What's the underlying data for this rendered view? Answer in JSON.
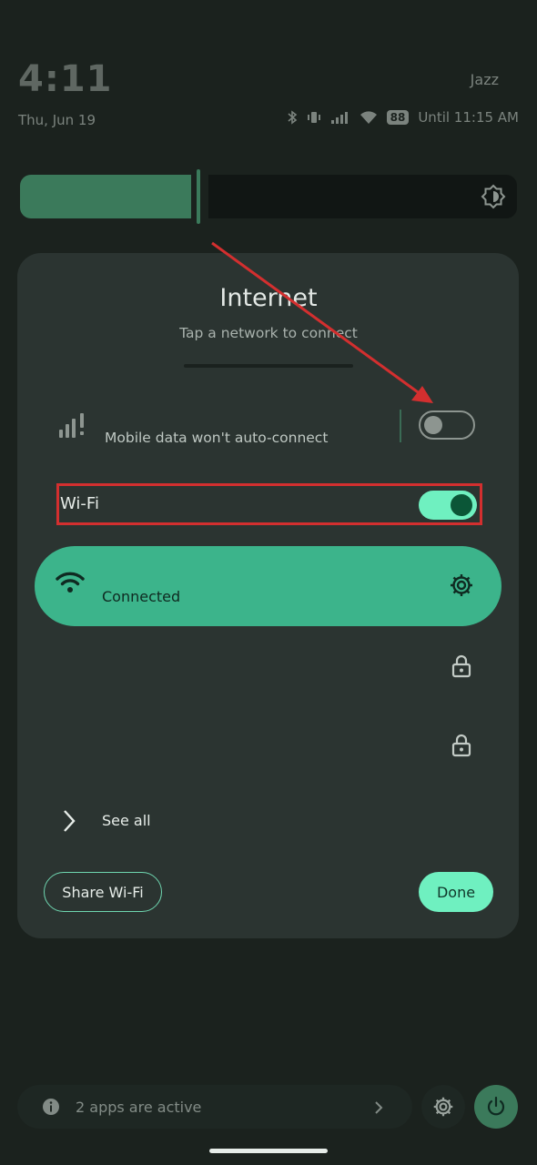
{
  "status_bar": {
    "time": "4:11",
    "date": "Thu, Jun 19",
    "carrier": "Jazz",
    "battery": "88",
    "alarm": "Until 11:15 AM"
  },
  "dialog": {
    "title": "Internet",
    "subtitle": "Tap a network to connect",
    "mobile_data_status": "Mobile data won't auto-connect",
    "mobile_data_enabled": false,
    "wifi_label": "Wi-Fi",
    "wifi_enabled": true,
    "connected_network_status": "Connected",
    "see_all_label": "See all",
    "share_button": "Share Wi-Fi",
    "done_button": "Done"
  },
  "bottom_bar": {
    "active_apps": "2 apps are active"
  },
  "annotations": {
    "highlight_color": "#d32f2f"
  },
  "colors": {
    "accent": "#6ff0c0",
    "connected_card": "#3cb48b",
    "dialog_bg": "#2b3431"
  }
}
